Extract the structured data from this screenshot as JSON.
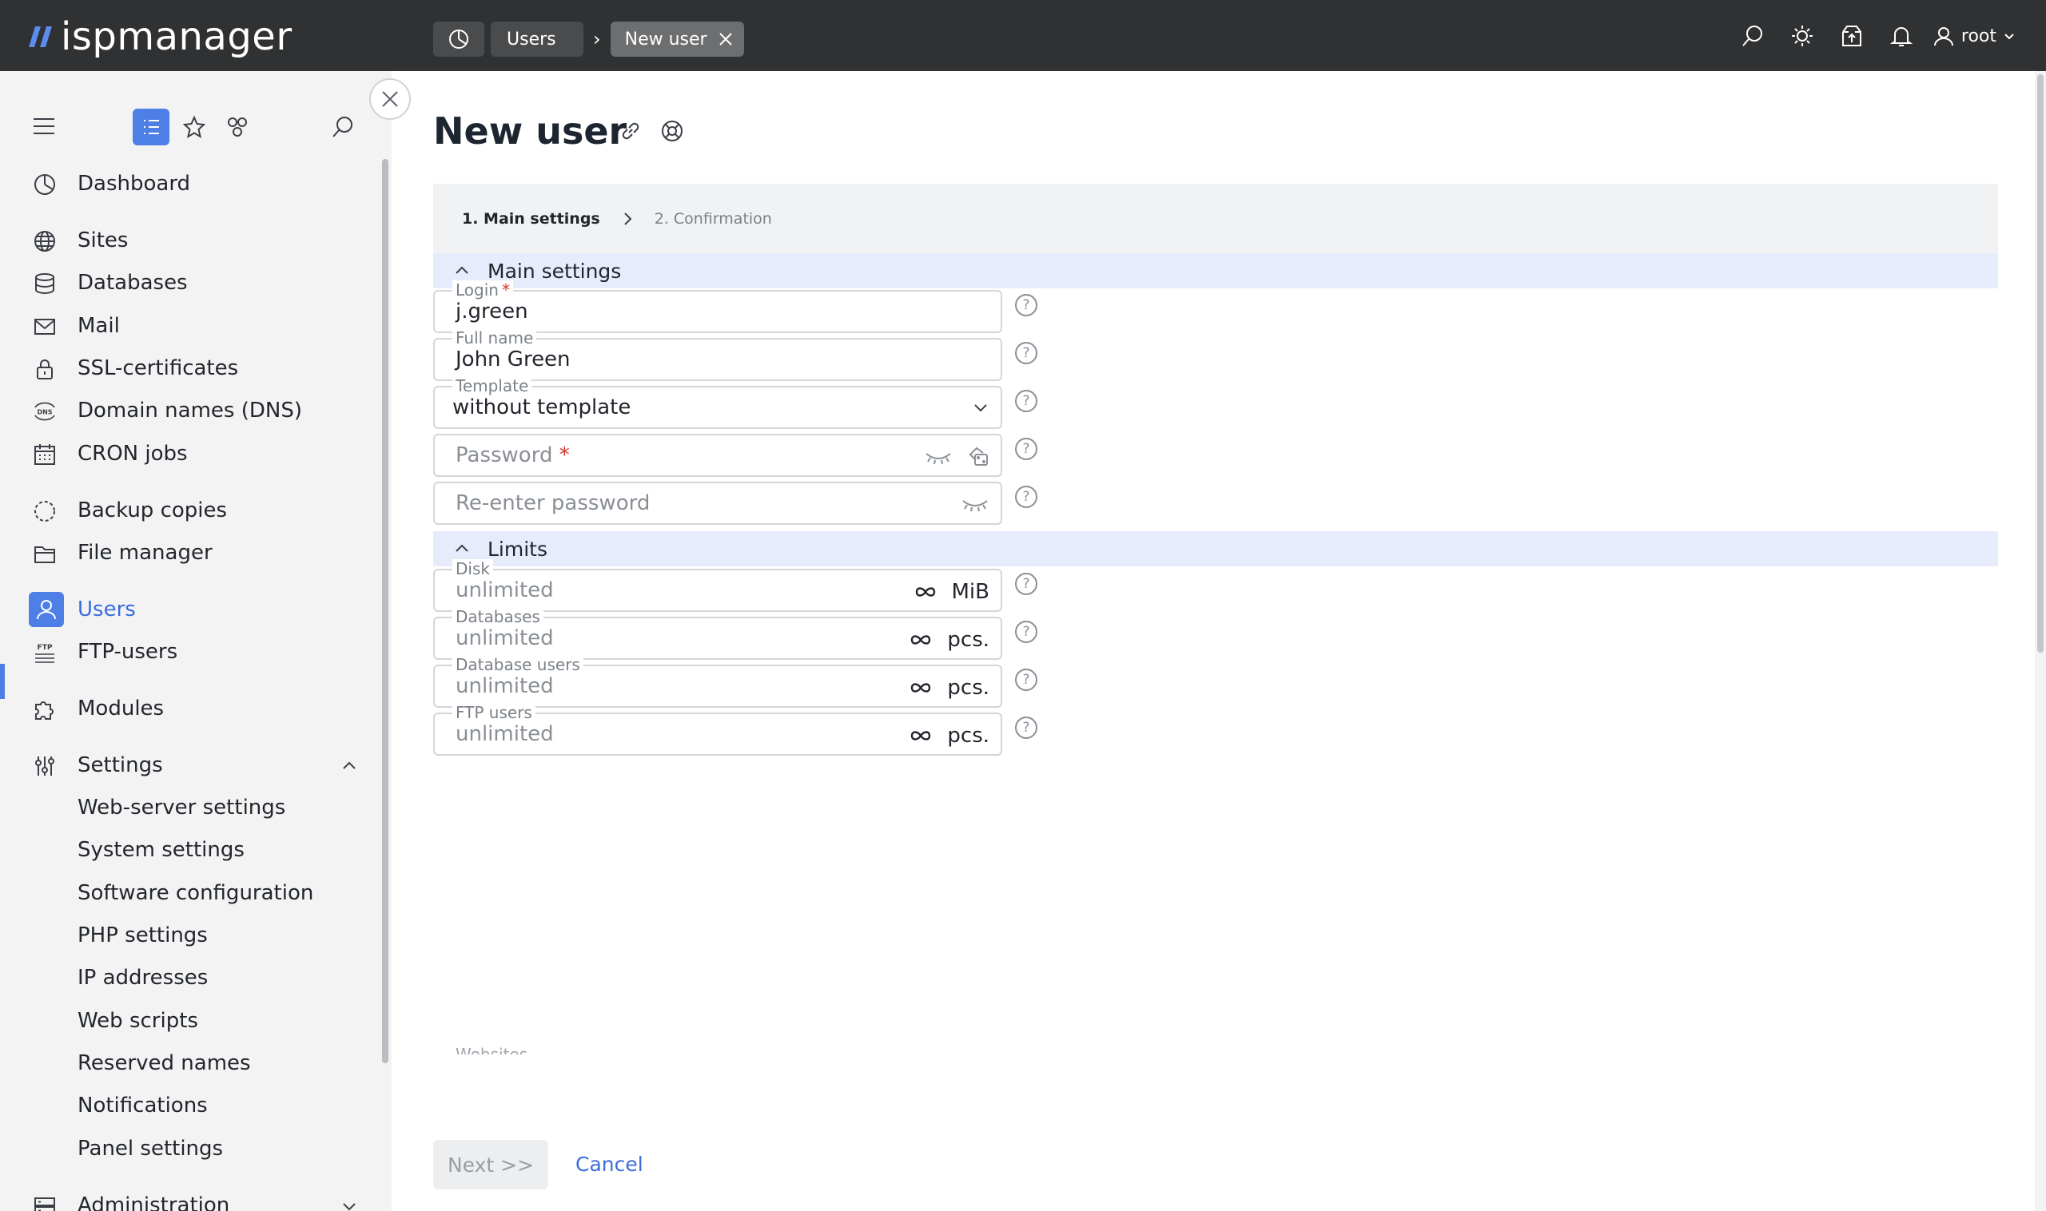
{
  "header": {
    "logo_text": "ispmanager",
    "breadcrumbs": [
      "Users",
      "New user"
    ],
    "user": "root"
  },
  "sidebar": {
    "items": [
      {
        "label": "Dashboard",
        "icon": "dashboard-icon"
      },
      {
        "label": "Sites",
        "icon": "globe-icon"
      },
      {
        "label": "Databases",
        "icon": "database-icon"
      },
      {
        "label": "Mail",
        "icon": "mail-icon"
      },
      {
        "label": "SSL-certificates",
        "icon": "lock-icon"
      },
      {
        "label": "Domain names (DNS)",
        "icon": "dns-icon"
      },
      {
        "label": "CRON jobs",
        "icon": "calendar-icon"
      },
      {
        "label": "Backup copies",
        "icon": "backup-icon"
      },
      {
        "label": "File manager",
        "icon": "folder-icon"
      },
      {
        "label": "Users",
        "icon": "user-icon",
        "active": true
      },
      {
        "label": "FTP-users",
        "icon": "ftp-icon"
      },
      {
        "label": "Modules",
        "icon": "puzzle-icon"
      },
      {
        "label": "Settings",
        "icon": "sliders-icon",
        "expanded": true
      },
      {
        "label": "Web-server settings"
      },
      {
        "label": "System settings"
      },
      {
        "label": "Software configuration"
      },
      {
        "label": "PHP settings"
      },
      {
        "label": "IP addresses"
      },
      {
        "label": "Web scripts"
      },
      {
        "label": "Reserved names"
      },
      {
        "label": "Notifications"
      },
      {
        "label": "Panel settings"
      },
      {
        "label": "Administration",
        "icon": "server-icon",
        "expanded": false
      }
    ]
  },
  "page": {
    "title": "New user",
    "steps": [
      "1. Main settings",
      "2. Confirmation"
    ]
  },
  "sections": {
    "main": "Main settings",
    "limits": "Limits"
  },
  "form": {
    "login": {
      "label": "Login",
      "value": "j.green",
      "required": "*"
    },
    "full_name": {
      "label": "Full name",
      "value": "John Green"
    },
    "template": {
      "label": "Template",
      "value": "without template"
    },
    "password": {
      "placeholder": "Password",
      "required": "*"
    },
    "repassword": {
      "placeholder": "Re-enter password"
    },
    "disk": {
      "label": "Disk",
      "value": "unlimited",
      "unit": "MiB"
    },
    "databases": {
      "label": "Databases",
      "value": "unlimited",
      "unit": "pcs."
    },
    "db_users": {
      "label": "Database users",
      "value": "unlimited",
      "unit": "pcs."
    },
    "ftp_users": {
      "label": "FTP users",
      "value": "unlimited",
      "unit": "pcs."
    },
    "next_cut_label": "Websites"
  },
  "help_glyph": "?",
  "footer": {
    "next": "Next >>",
    "cancel": "Cancel"
  },
  "colors": {
    "topbar": "#303132",
    "accent": "#4d7fe6",
    "section_bg": "#e6ecfb",
    "sidebar_bg": "#f3f3f4"
  }
}
